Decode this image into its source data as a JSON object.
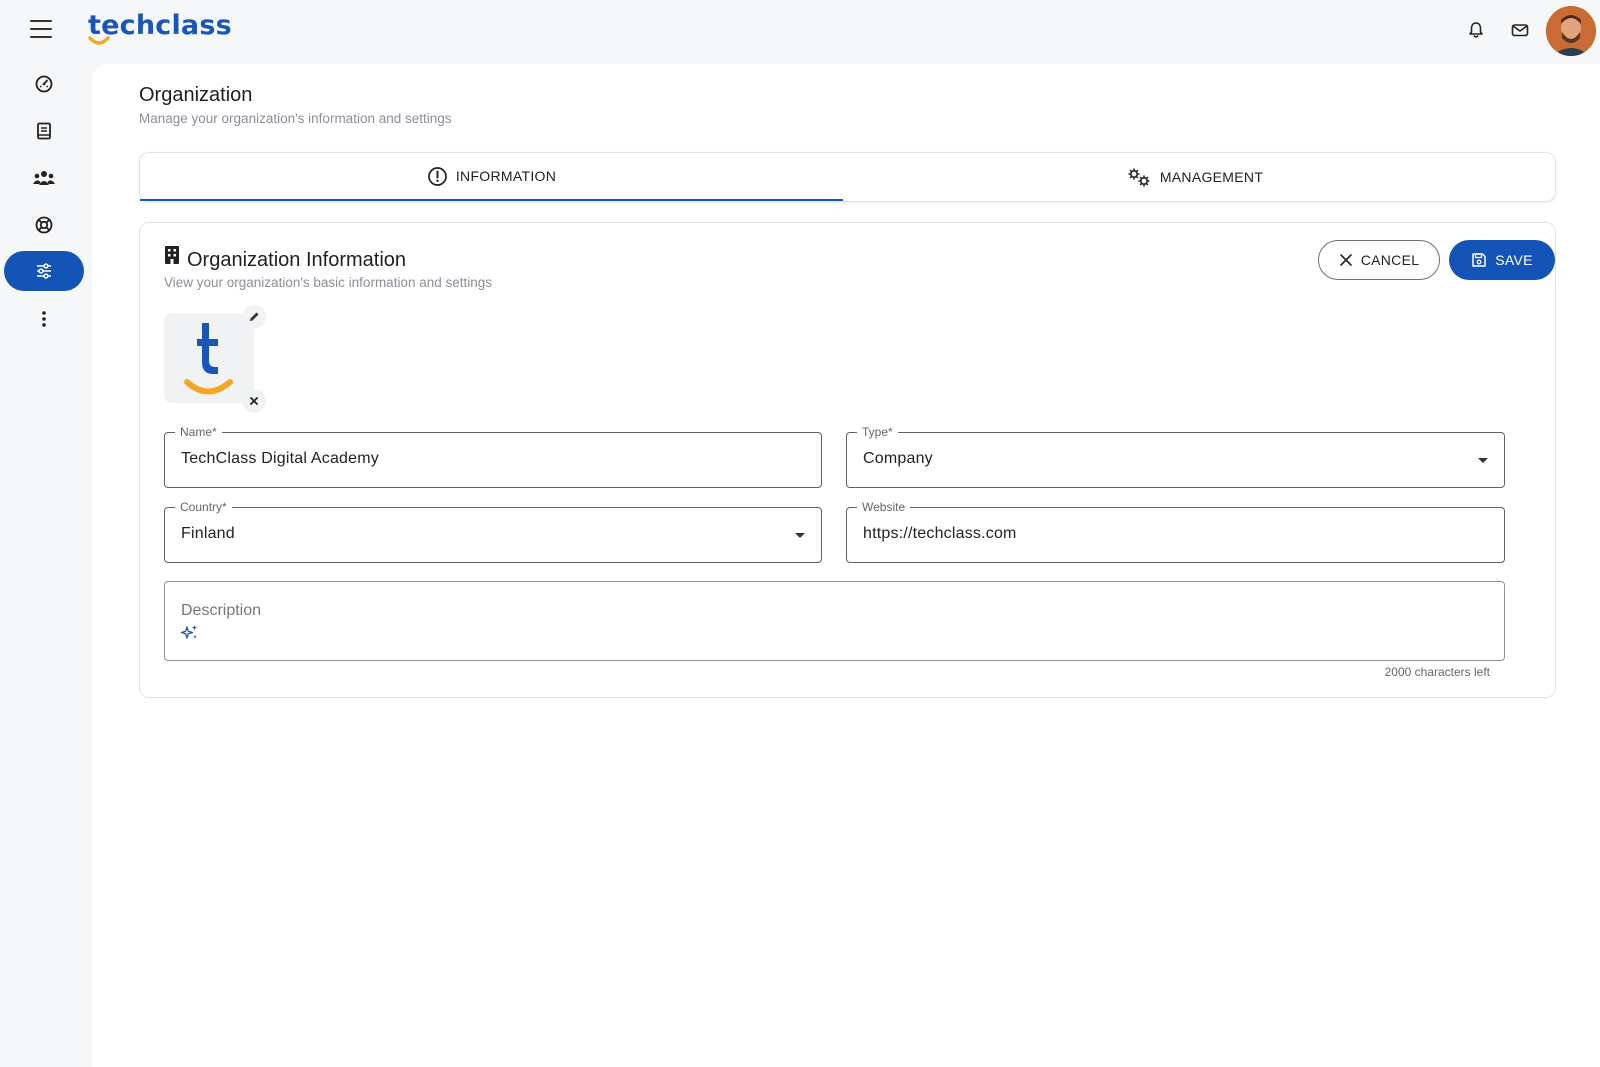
{
  "brand": {
    "name": "techclass"
  },
  "page": {
    "title": "Organization",
    "subtitle": "Manage your organization's information and settings"
  },
  "tabs": [
    {
      "label": "INFORMATION",
      "icon": "info-circle-icon",
      "active": true
    },
    {
      "label": "MANAGEMENT",
      "icon": "gears-icon",
      "active": false
    }
  ],
  "sidebar": {
    "items": [
      {
        "name": "dashboard",
        "icon": "speedometer-icon",
        "active": false
      },
      {
        "name": "courses",
        "icon": "book-icon",
        "active": false
      },
      {
        "name": "users",
        "icon": "users-icon",
        "active": false
      },
      {
        "name": "support",
        "icon": "lifebuoy-icon",
        "active": false
      },
      {
        "name": "settings",
        "icon": "sliders-icon",
        "active": true
      },
      {
        "name": "more",
        "icon": "more-vertical-icon",
        "active": false
      }
    ]
  },
  "card": {
    "title": "Organization Information",
    "subtitle": "View your organization's basic information and settings",
    "cancel_label": "CANCEL",
    "save_label": "SAVE"
  },
  "form": {
    "name": {
      "label": "Name*",
      "value": "TechClass Digital Academy"
    },
    "type": {
      "label": "Type*",
      "value": "Company"
    },
    "country": {
      "label": "Country*",
      "value": "Finland"
    },
    "website": {
      "label": "Website",
      "value": "https://techclass.com"
    },
    "description": {
      "placeholder": "Description",
      "chars_left": "2000 characters left"
    }
  },
  "colors": {
    "primary": "#1354b6",
    "logo_orange": "#f5a623",
    "background": "#f6f7f9"
  }
}
